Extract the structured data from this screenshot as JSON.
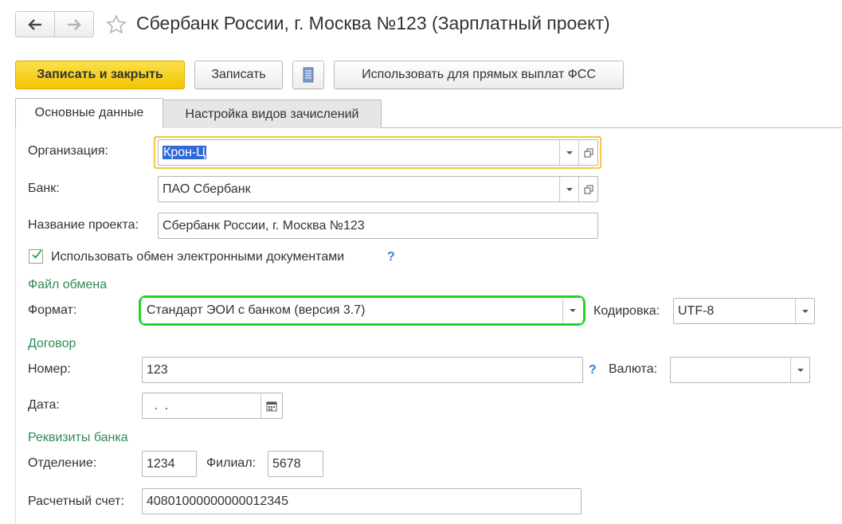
{
  "window": {
    "title": "Сбербанк России, г. Москва №123 (Зарплатный проект)"
  },
  "toolbar": {
    "save_close_label": "Записать и закрыть",
    "save_label": "Записать",
    "fss_label": "Использовать для прямых выплат ФСС"
  },
  "tabs": [
    {
      "label": "Основные данные",
      "active": true
    },
    {
      "label": "Настройка видов зачислений",
      "active": false
    }
  ],
  "form": {
    "organization": {
      "label": "Организация:",
      "value": "Крон-Ц"
    },
    "bank": {
      "label": "Банк:",
      "value": "ПАО Сбербанк"
    },
    "project_name": {
      "label": "Название проекта:",
      "value": "Сбербанк России, г. Москва №123"
    },
    "edo": {
      "label": "Использовать обмен электронными документами",
      "checked": true,
      "help": "?"
    },
    "exchange_section": "Файл обмена",
    "format": {
      "label": "Формат:",
      "value": "Стандарт ЭОИ с банком (версия 3.7)"
    },
    "encoding": {
      "label": "Кодировка:",
      "value": "UTF-8"
    },
    "contract_section": "Договор",
    "number": {
      "label": "Номер:",
      "value": "123",
      "help": "?"
    },
    "currency": {
      "label": "Валюта:",
      "value": ""
    },
    "date": {
      "label": "Дата:",
      "value": " .  ."
    },
    "bank_details_section": "Реквизиты банка",
    "branch_dept": {
      "label": "Отделение:",
      "value": "1234"
    },
    "branch": {
      "label": "Филиал:",
      "value": "5678"
    },
    "account": {
      "label": "Расчетный счет:",
      "value": "40801000000000012345"
    }
  },
  "colors": {
    "primary_button": "#f2c500",
    "section_header": "#2e8b57",
    "focus_border": "#f5c542",
    "highlight_border": "#22d12e",
    "help": "#3a7fd5",
    "selection": "#2f6ad6"
  }
}
